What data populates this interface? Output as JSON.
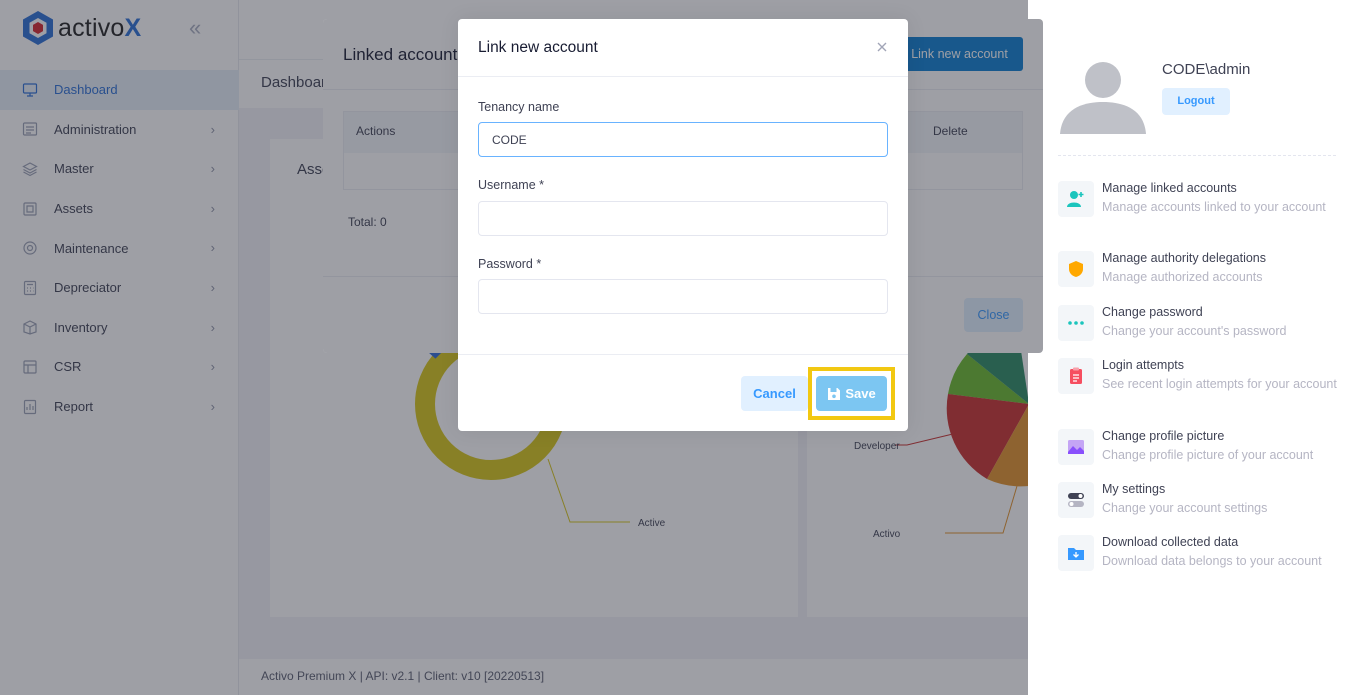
{
  "brand": {
    "name_prefix": "activo",
    "name_suffix": "X"
  },
  "sidebar": {
    "items": [
      {
        "label": "Dashboard",
        "icon": "dashboard-icon",
        "active": true
      },
      {
        "label": "Administration",
        "icon": "administration-icon"
      },
      {
        "label": "Master",
        "icon": "layers-icon"
      },
      {
        "label": "Assets",
        "icon": "assets-icon"
      },
      {
        "label": "Maintenance",
        "icon": "gear-icon"
      },
      {
        "label": "Depreciator",
        "icon": "calculator-icon"
      },
      {
        "label": "Inventory",
        "icon": "inventory-icon"
      },
      {
        "label": "CSR",
        "icon": "csr-icon"
      },
      {
        "label": "Report",
        "icon": "report-icon"
      }
    ]
  },
  "page": {
    "title": "Dashboard",
    "card_left_title": "Assets"
  },
  "charts": {
    "left_label": "Active",
    "right_labels": [
      "Developer",
      "Activo"
    ]
  },
  "footer": {
    "text": "Activo Premium X | API: v2.1 | Client: v10 [20220513]"
  },
  "linked_modal": {
    "title": "Linked accounts",
    "link_button": "Link new account",
    "col_actions": "Actions",
    "col_delete": "Delete",
    "total": "Total: 0",
    "close_button": "Close"
  },
  "new_account_modal": {
    "title": "Link new account",
    "tenancy_label": "Tenancy name",
    "tenancy_value": "CODE",
    "username_label": "Username *",
    "username_value": "",
    "password_label": "Password *",
    "password_value": "",
    "cancel_button": "Cancel",
    "save_button": "Save"
  },
  "user_panel": {
    "username": "CODE\\admin",
    "logout": "Logout",
    "items": [
      {
        "title": "Manage linked accounts",
        "desc": "Manage accounts linked to your account",
        "icon": "user-plus-icon"
      },
      {
        "title": "Manage authority delegations",
        "desc": "Manage authorized accounts",
        "icon": "shield-icon"
      },
      {
        "title": "Change password",
        "desc": "Change your account's password",
        "icon": "dots-icon"
      },
      {
        "title": "Login attempts",
        "desc": "See recent login attempts for your account",
        "icon": "clipboard-icon"
      },
      {
        "title": "Change profile picture",
        "desc": "Change profile picture of your account",
        "icon": "image-icon"
      },
      {
        "title": "My settings",
        "desc": "Change your account settings",
        "icon": "toggle-icon"
      },
      {
        "title": "Download collected data",
        "desc": "Download data belongs to your account",
        "icon": "folder-download-icon"
      }
    ]
  },
  "colors": {
    "primary": "#3699ff",
    "link_button": "#0b7fd1",
    "highlight": "#f2c811",
    "sidebar_active": "#2a6fd6"
  }
}
